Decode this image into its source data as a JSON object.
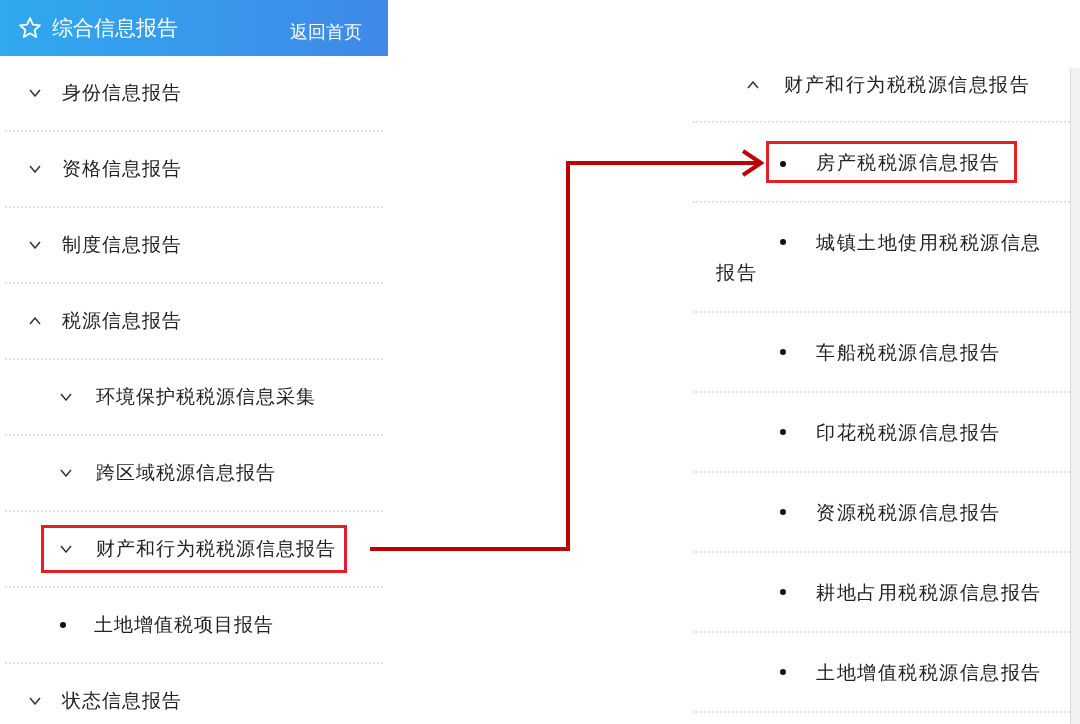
{
  "sidebar": {
    "header": {
      "title": "综合信息报告",
      "link": "返回首页"
    },
    "items": [
      {
        "label": "身份信息报告",
        "kind": "group",
        "expanded": false,
        "highlighted": false
      },
      {
        "label": "资格信息报告",
        "kind": "group",
        "expanded": false,
        "highlighted": false
      },
      {
        "label": "制度信息报告",
        "kind": "group",
        "expanded": false,
        "highlighted": false
      },
      {
        "label": "税源信息报告",
        "kind": "group",
        "expanded": true,
        "highlighted": false,
        "children": [
          {
            "label": "环境保护税税源信息采集",
            "kind": "group",
            "expanded": false,
            "highlighted": false
          },
          {
            "label": "跨区域税源信息报告",
            "kind": "group",
            "expanded": false,
            "highlighted": false
          },
          {
            "label": "财产和行为税税源信息报告",
            "kind": "group",
            "expanded": false,
            "highlighted": true
          },
          {
            "label": "土地增值税项目报告",
            "kind": "leaf",
            "highlighted": false
          }
        ]
      },
      {
        "label": "状态信息报告",
        "kind": "group",
        "expanded": false,
        "highlighted": false
      }
    ]
  },
  "submenu": {
    "label": "财产和行为税税源信息报告",
    "expanded": true,
    "children": [
      {
        "label": "房产税税源信息报告",
        "highlighted": true
      },
      {
        "label": "城镇土地使用税税源信息报告",
        "highlighted": false
      },
      {
        "label": "车船税税源信息报告",
        "highlighted": false
      },
      {
        "label": "印花税税源信息报告",
        "highlighted": false
      },
      {
        "label": "资源税税源信息报告",
        "highlighted": false
      },
      {
        "label": "耕地占用税税源信息报告",
        "highlighted": false
      },
      {
        "label": "土地增值税税源信息报告",
        "highlighted": false
      }
    ]
  }
}
